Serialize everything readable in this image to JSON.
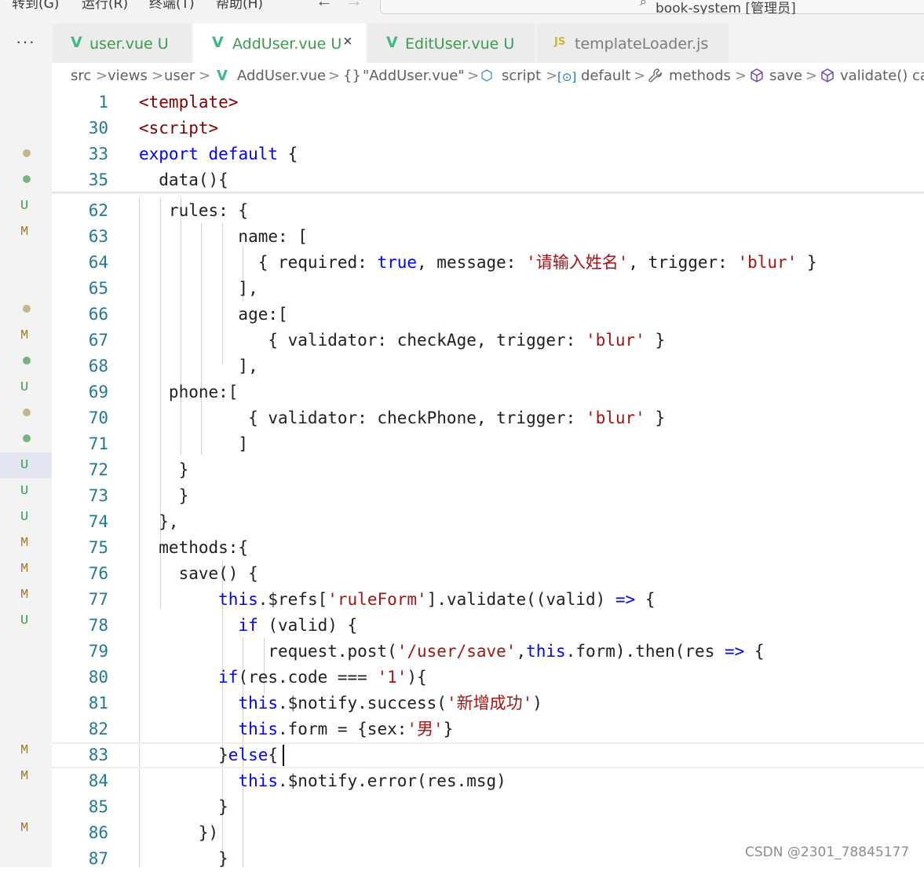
{
  "menubar": {
    "items": [
      "转到(G)",
      "运行(R)",
      "终端(T)",
      "帮助(H)"
    ],
    "back_icon": "arrow-left-icon",
    "forward_icon": "arrow-right-icon",
    "search_title": "book-system [管理员]"
  },
  "activity": {
    "more_icon": "ellipsis-icon",
    "more_label": "···"
  },
  "tabs": [
    {
      "label": "user.vue",
      "status": "U",
      "icon": "vue-icon",
      "icon_glyph": "V",
      "active": false
    },
    {
      "label": "AddUser.vue",
      "status": "U",
      "icon": "vue-icon",
      "icon_glyph": "V",
      "active": true,
      "close": "×"
    },
    {
      "label": "EditUser.vue",
      "status": "U",
      "icon": "vue-icon",
      "icon_glyph": "V",
      "active": false
    },
    {
      "label": "templateLoader.js",
      "status": "",
      "icon": "js-icon",
      "icon_glyph": "JS",
      "active": false
    }
  ],
  "breadcrumb": {
    "items": [
      "src",
      "views",
      "user",
      "AddUser.vue",
      "\"AddUser.vue\"",
      "script",
      "default",
      "methods",
      "save",
      "validate() cal"
    ],
    "separator": ">",
    "icons": {
      "vue": "V",
      "braces": "{}",
      "script": "⬡",
      "default": "[⊙]",
      "methods": "🔧",
      "cube": "⬡"
    }
  },
  "gutter_marks": [
    {
      "kind": "dot",
      "color": "#c8b48c"
    },
    {
      "kind": "dot",
      "color": "#7bb37b"
    },
    {
      "kind": "letter",
      "text": "U",
      "color": "#3f9a4f"
    },
    {
      "kind": "letter",
      "text": "M",
      "color": "#9e7a2e"
    },
    {
      "kind": "blank"
    },
    {
      "kind": "blank"
    },
    {
      "kind": "dot",
      "color": "#c8b48c"
    },
    {
      "kind": "letter",
      "text": "M",
      "color": "#9e7a2e"
    },
    {
      "kind": "dot",
      "color": "#7bb37b"
    },
    {
      "kind": "letter",
      "text": "U",
      "color": "#3f9a4f"
    },
    {
      "kind": "dot",
      "color": "#c8b48c"
    },
    {
      "kind": "dot",
      "color": "#7bb37b"
    },
    {
      "kind": "letter",
      "text": "U",
      "color": "#3f9a4f",
      "selected": true
    },
    {
      "kind": "letter",
      "text": "U",
      "color": "#3f9a4f"
    },
    {
      "kind": "letter",
      "text": "U",
      "color": "#3f9a4f"
    },
    {
      "kind": "letter",
      "text": "M",
      "color": "#9e7a2e"
    },
    {
      "kind": "letter",
      "text": "M",
      "color": "#9e7a2e"
    },
    {
      "kind": "letter",
      "text": "M",
      "color": "#9e7a2e"
    },
    {
      "kind": "letter",
      "text": "U",
      "color": "#3f9a4f"
    },
    {
      "kind": "blank"
    },
    {
      "kind": "blank"
    },
    {
      "kind": "blank"
    },
    {
      "kind": "blank"
    },
    {
      "kind": "letter",
      "text": "M",
      "color": "#9e7a2e"
    },
    {
      "kind": "letter",
      "text": "M",
      "color": "#9e7a2e"
    },
    {
      "kind": "blank"
    },
    {
      "kind": "letter",
      "text": "M",
      "color": "#9e7a2e"
    }
  ],
  "editor": {
    "sticky_lines": [
      {
        "n": "1",
        "tokens": [
          [
            "tag",
            "<template>"
          ]
        ]
      },
      {
        "n": "30",
        "tokens": [
          [
            "tag",
            "<script>"
          ]
        ]
      },
      {
        "n": "33",
        "tokens": [
          [
            "kw",
            "export"
          ],
          [
            "plain",
            " "
          ],
          [
            "kw",
            "default"
          ],
          [
            "plain",
            " {"
          ]
        ]
      },
      {
        "n": "35",
        "tokens": [
          [
            "plain",
            "  data(){"
          ]
        ]
      }
    ],
    "lines": [
      {
        "n": "62",
        "tokens": [
          [
            "plain",
            "   rules: {"
          ]
        ]
      },
      {
        "n": "63",
        "tokens": [
          [
            "plain",
            "          name: ["
          ]
        ]
      },
      {
        "n": "64",
        "tokens": [
          [
            "plain",
            "            { required: "
          ],
          [
            "kw",
            "true"
          ],
          [
            "plain",
            ", message: "
          ],
          [
            "str",
            "'请输入姓名'"
          ],
          [
            "plain",
            ", trigger: "
          ],
          [
            "str",
            "'blur'"
          ],
          [
            "plain",
            " }"
          ]
        ]
      },
      {
        "n": "65",
        "tokens": [
          [
            "plain",
            "          ],"
          ]
        ]
      },
      {
        "n": "66",
        "tokens": [
          [
            "plain",
            "          age:["
          ]
        ]
      },
      {
        "n": "67",
        "tokens": [
          [
            "plain",
            "             { validator: checkAge, trigger: "
          ],
          [
            "str",
            "'blur'"
          ],
          [
            "plain",
            " }"
          ]
        ]
      },
      {
        "n": "68",
        "tokens": [
          [
            "plain",
            "          ],"
          ]
        ]
      },
      {
        "n": "69",
        "tokens": [
          [
            "plain",
            "   phone:["
          ]
        ]
      },
      {
        "n": "70",
        "tokens": [
          [
            "plain",
            "           { validator: checkPhone, trigger: "
          ],
          [
            "str",
            "'blur'"
          ],
          [
            "plain",
            " }"
          ]
        ]
      },
      {
        "n": "71",
        "tokens": [
          [
            "plain",
            "          ]"
          ]
        ]
      },
      {
        "n": "72",
        "tokens": [
          [
            "plain",
            "    }"
          ]
        ]
      },
      {
        "n": "73",
        "tokens": [
          [
            "plain",
            "    }"
          ]
        ]
      },
      {
        "n": "74",
        "tokens": [
          [
            "plain",
            "  },"
          ]
        ]
      },
      {
        "n": "75",
        "tokens": [
          [
            "plain",
            "  methods:{"
          ]
        ]
      },
      {
        "n": "76",
        "tokens": [
          [
            "plain",
            "    save() {"
          ]
        ]
      },
      {
        "n": "77",
        "tokens": [
          [
            "plain",
            "        "
          ],
          [
            "kw",
            "this"
          ],
          [
            "plain",
            ".$refs["
          ],
          [
            "str",
            "'ruleForm'"
          ],
          [
            "plain",
            "].validate((valid) "
          ],
          [
            "kw",
            "=>"
          ],
          [
            "plain",
            " {"
          ]
        ]
      },
      {
        "n": "78",
        "tokens": [
          [
            "plain",
            "          "
          ],
          [
            "kw",
            "if"
          ],
          [
            "plain",
            " (valid) {"
          ]
        ]
      },
      {
        "n": "79",
        "tokens": [
          [
            "plain",
            "             request.post("
          ],
          [
            "str",
            "'/user/save'"
          ],
          [
            "plain",
            ","
          ],
          [
            "kw",
            "this"
          ],
          [
            "plain",
            ".form).then(res "
          ],
          [
            "kw",
            "=>"
          ],
          [
            "plain",
            " {"
          ]
        ]
      },
      {
        "n": "80",
        "tokens": [
          [
            "plain",
            "        "
          ],
          [
            "kw",
            "if"
          ],
          [
            "plain",
            "(res.code === "
          ],
          [
            "str",
            "'1'"
          ],
          [
            "plain",
            "){"
          ]
        ]
      },
      {
        "n": "81",
        "tokens": [
          [
            "plain",
            "          "
          ],
          [
            "kw",
            "this"
          ],
          [
            "plain",
            ".$notify.success("
          ],
          [
            "str",
            "'新增成功'"
          ],
          [
            "plain",
            ")"
          ]
        ]
      },
      {
        "n": "82",
        "tokens": [
          [
            "plain",
            "          "
          ],
          [
            "kw",
            "this"
          ],
          [
            "plain",
            ".form = {sex:"
          ],
          [
            "str",
            "'男'"
          ],
          [
            "plain",
            "}"
          ]
        ]
      },
      {
        "n": "83",
        "tokens": [
          [
            "plain",
            "        }"
          ],
          [
            "kw",
            "else"
          ],
          [
            "plain",
            "{"
          ]
        ],
        "current": true
      },
      {
        "n": "84",
        "tokens": [
          [
            "plain",
            "          "
          ],
          [
            "kw",
            "this"
          ],
          [
            "plain",
            ".$notify.error(res.msg)"
          ]
        ]
      },
      {
        "n": "85",
        "tokens": [
          [
            "plain",
            "        }"
          ]
        ]
      },
      {
        "n": "86",
        "tokens": [
          [
            "plain",
            "      })"
          ]
        ]
      },
      {
        "n": "87",
        "tokens": [
          [
            "plain",
            "        }"
          ]
        ]
      }
    ]
  },
  "watermark": "CSDN @2301_78845177",
  "colors": {
    "keyword": "#0000ff",
    "string": "#a31515",
    "tag": "#800000",
    "line_number": "#237893",
    "untracked": "#3f9a4f",
    "modified": "#9e7a2e"
  }
}
